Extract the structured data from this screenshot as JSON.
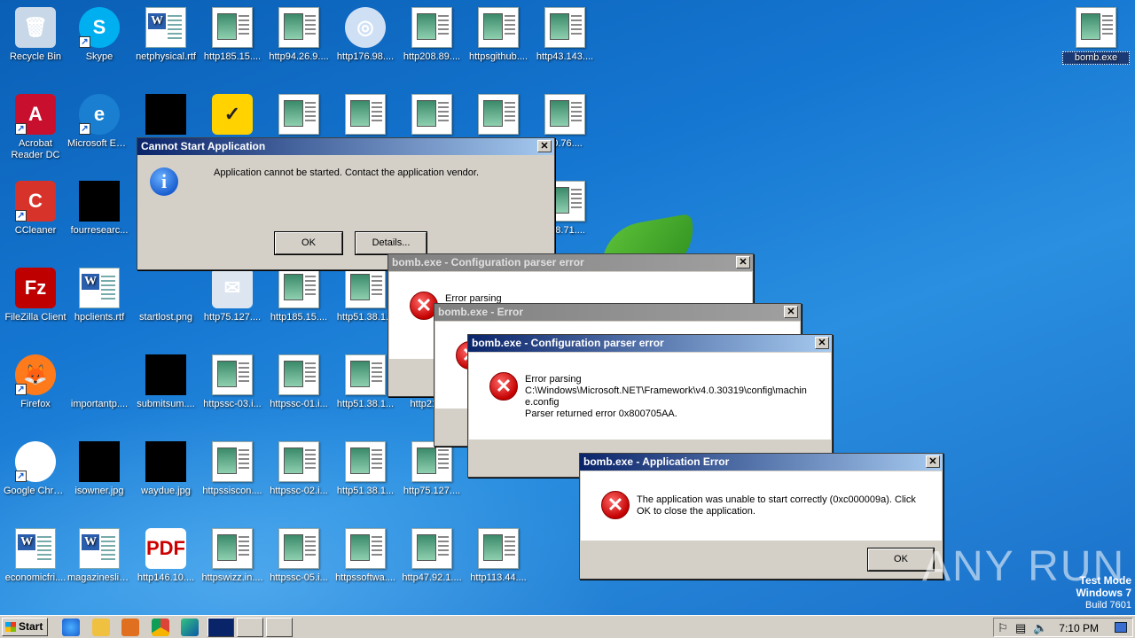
{
  "desktop": {
    "icons": [
      {
        "label": "Recycle Bin",
        "kind": "recycle",
        "col": 0,
        "row": 0
      },
      {
        "label": "Skype",
        "kind": "skype",
        "col": 1,
        "row": 0
      },
      {
        "label": "netphysical.rtf",
        "kind": "doc",
        "col": 2,
        "row": 0
      },
      {
        "label": "http185.15....",
        "kind": "html",
        "col": 3,
        "row": 0
      },
      {
        "label": "http94.26.9....",
        "kind": "html",
        "col": 4,
        "row": 0
      },
      {
        "label": "http176.98....",
        "kind": "cd",
        "col": 5,
        "row": 0
      },
      {
        "label": "http208.89....",
        "kind": "html",
        "col": 6,
        "row": 0
      },
      {
        "label": "httpsgithub....",
        "kind": "html",
        "col": 7,
        "row": 0
      },
      {
        "label": "http43.143....",
        "kind": "html",
        "col": 8,
        "row": 0
      },
      {
        "label": "Acrobat Reader DC",
        "kind": "acrobat",
        "col": 0,
        "row": 1
      },
      {
        "label": "Microsoft Edge",
        "kind": "edge",
        "col": 1,
        "row": 1
      },
      {
        "label": "",
        "kind": "black",
        "col": 2,
        "row": 1
      },
      {
        "label": "",
        "kind": "norton",
        "col": 3,
        "row": 1
      },
      {
        "label": "",
        "kind": "html",
        "col": 4,
        "row": 1
      },
      {
        "label": "",
        "kind": "html",
        "col": 5,
        "row": 1
      },
      {
        "label": "",
        "kind": "html",
        "col": 6,
        "row": 1
      },
      {
        "label": "",
        "kind": "html",
        "col": 7,
        "row": 1
      },
      {
        "label": "80.76....",
        "kind": "html",
        "col": 8,
        "row": 1
      },
      {
        "label": "CCleaner",
        "kind": "ccleaner",
        "col": 0,
        "row": 2
      },
      {
        "label": "fourresearc...",
        "kind": "black",
        "col": 1,
        "row": 2
      },
      {
        "label": "208.71....",
        "kind": "html",
        "col": 8,
        "row": 2
      },
      {
        "label": "FileZilla Client",
        "kind": "filezilla",
        "col": 0,
        "row": 3
      },
      {
        "label": "hpclients.rtf",
        "kind": "doc",
        "col": 1,
        "row": 3
      },
      {
        "label": "startlost.png",
        "kind": "blank",
        "col": 2,
        "row": 3
      },
      {
        "label": "http75.127....",
        "kind": "mail",
        "col": 3,
        "row": 3
      },
      {
        "label": "http185.15....",
        "kind": "html",
        "col": 4,
        "row": 3
      },
      {
        "label": "http51.38.1...",
        "kind": "html",
        "col": 5,
        "row": 3
      },
      {
        "label": "Firefox",
        "kind": "firefox",
        "col": 0,
        "row": 4
      },
      {
        "label": "importantp....",
        "kind": "blank",
        "col": 1,
        "row": 4
      },
      {
        "label": "submitsum....",
        "kind": "black",
        "col": 2,
        "row": 4
      },
      {
        "label": "httpssc-03.i...",
        "kind": "html",
        "col": 3,
        "row": 4
      },
      {
        "label": "httpssc-01.i...",
        "kind": "html",
        "col": 4,
        "row": 4
      },
      {
        "label": "http51.38.1...",
        "kind": "html",
        "col": 5,
        "row": 4
      },
      {
        "label": "http213....",
        "kind": "html",
        "col": 6,
        "row": 4
      },
      {
        "label": "Google Chrome",
        "kind": "chrome",
        "col": 0,
        "row": 5
      },
      {
        "label": "isowner.jpg",
        "kind": "black",
        "col": 1,
        "row": 5
      },
      {
        "label": "waydue.jpg",
        "kind": "black",
        "col": 2,
        "row": 5
      },
      {
        "label": "httpssiscon....",
        "kind": "html",
        "col": 3,
        "row": 5
      },
      {
        "label": "httpssc-02.i...",
        "kind": "html",
        "col": 4,
        "row": 5
      },
      {
        "label": "http51.38.1...",
        "kind": "html",
        "col": 5,
        "row": 5
      },
      {
        "label": "http75.127....",
        "kind": "html",
        "col": 6,
        "row": 5
      },
      {
        "label": "economicfri....",
        "kind": "doc",
        "col": 0,
        "row": 6
      },
      {
        "label": "magazineslic....",
        "kind": "doc",
        "col": 1,
        "row": 6
      },
      {
        "label": "http146.10....",
        "kind": "pdf",
        "col": 2,
        "row": 6
      },
      {
        "label": "httpswizz.in....",
        "kind": "html",
        "col": 3,
        "row": 6
      },
      {
        "label": "httpssc-05.i...",
        "kind": "html",
        "col": 4,
        "row": 6
      },
      {
        "label": "httpssoftwa....",
        "kind": "html",
        "col": 5,
        "row": 6
      },
      {
        "label": "http47.92.1....",
        "kind": "html",
        "col": 6,
        "row": 6
      },
      {
        "label": "http113.44....",
        "kind": "html",
        "col": 7,
        "row": 6
      }
    ],
    "topright_icon": {
      "label": "bomb.exe"
    }
  },
  "dialogs": {
    "cannot_start": {
      "title": "Cannot Start Application",
      "message": "Application cannot be started. Contact the application vendor.",
      "ok": "OK",
      "details": "Details..."
    },
    "config_back": {
      "title": "bomb.exe - Configuration parser error",
      "message": "Error parsing"
    },
    "error_mid": {
      "title": "bomb.exe - Error"
    },
    "config_front": {
      "title": "bomb.exe - Configuration parser error",
      "line1": "Error parsing",
      "line2": "C:\\Windows\\Microsoft.NET\\Framework\\v4.0.30319\\config\\machin",
      "line3": "e.config",
      "line4": "Parser returned error 0x800705AA."
    },
    "app_error": {
      "title": "bomb.exe - Application Error",
      "line1": "The application was unable to start correctly (0xc000009a). Click",
      "line2": "OK to close the application.",
      "ok": "OK"
    },
    "close_glyph": "✕"
  },
  "taskbar": {
    "start": "Start",
    "clock": "7:10 PM"
  },
  "watermark": {
    "line1": "Test Mode",
    "line2": "Windows 7",
    "line3": "Build 7601",
    "brand": "ANY RUN"
  }
}
